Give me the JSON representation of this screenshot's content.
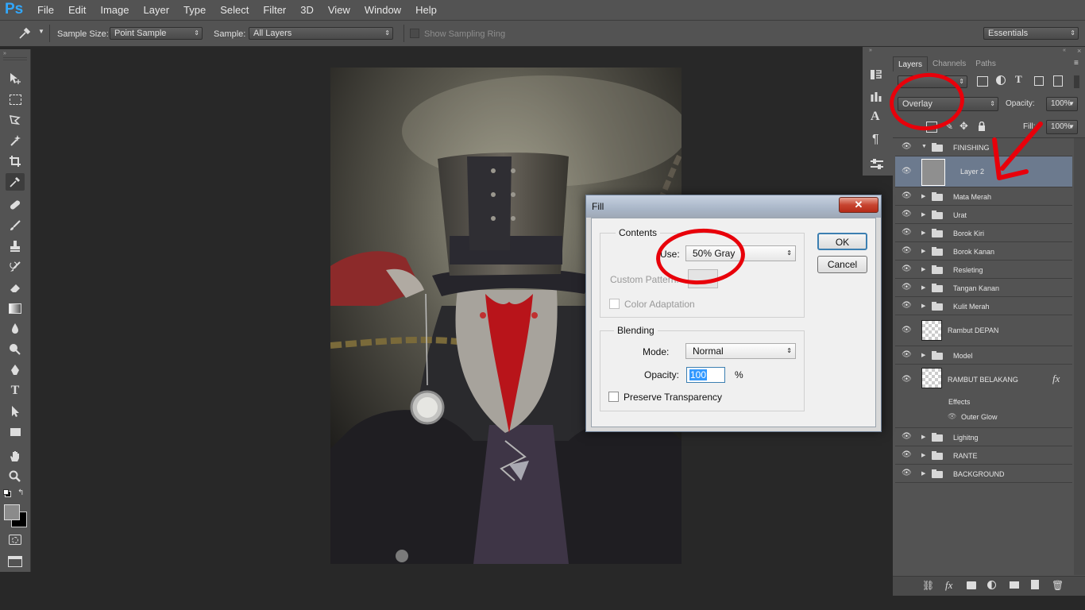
{
  "app": {
    "logo": "Ps"
  },
  "menu": [
    "File",
    "Edit",
    "Image",
    "Layer",
    "Type",
    "Select",
    "Filter",
    "3D",
    "View",
    "Window",
    "Help"
  ],
  "options": {
    "sample_size_label": "Sample Size:",
    "sample_size_value": "Point Sample",
    "sample_label": "Sample:",
    "sample_value": "All Layers",
    "show_ring": "Show Sampling Ring",
    "workspace": "Essentials"
  },
  "tools": [
    "move-tool",
    "marquee-tool",
    "lasso-tool",
    "magic-wand-tool",
    "crop-tool",
    "eyedropper-tool",
    "healing-brush-tool",
    "brush-tool",
    "clone-stamp-tool",
    "history-brush-tool",
    "eraser-tool",
    "gradient-tool",
    "blur-tool",
    "dodge-tool",
    "pen-tool",
    "type-tool",
    "path-selection-tool",
    "rectangle-tool",
    "hand-tool",
    "zoom-tool"
  ],
  "layers_panel": {
    "tabs": [
      "Layers",
      "Channels",
      "Paths"
    ],
    "blend_mode": "Overlay",
    "opacity_label": "Opacity:",
    "opacity_value": "100%",
    "fill_label": "Fill:",
    "fill_value": "100%",
    "layers": [
      {
        "name": "FINISHING",
        "type": "group",
        "expanded": true
      },
      {
        "name": "Layer 2",
        "type": "layer",
        "selected": true
      },
      {
        "name": "Mata Merah",
        "type": "group"
      },
      {
        "name": "Urat",
        "type": "group"
      },
      {
        "name": "Borok Kiri",
        "type": "group"
      },
      {
        "name": "Borok Kanan",
        "type": "group"
      },
      {
        "name": "Resleting",
        "type": "group"
      },
      {
        "name": "Tangan Kanan",
        "type": "group"
      },
      {
        "name": "Kulit Merah",
        "type": "group"
      },
      {
        "name": "Rambut DEPAN",
        "type": "pixel"
      },
      {
        "name": "Model",
        "type": "group"
      },
      {
        "name": "RAMBUT BELAKANG",
        "type": "pixel",
        "fx": "fx"
      },
      {
        "name": "Effects",
        "type": "effects"
      },
      {
        "name": "Outer Glow",
        "type": "effect"
      },
      {
        "name": "Lighitng",
        "type": "group"
      },
      {
        "name": "RANTE",
        "type": "group"
      },
      {
        "name": "BACKGROUND",
        "type": "group"
      }
    ]
  },
  "dialog": {
    "title": "Fill",
    "contents_legend": "Contents",
    "use_label": "Use:",
    "use_value": "50% Gray",
    "custom_pattern": "Custom Pattern:",
    "color_adaptation": "Color Adaptation",
    "blending_legend": "Blending",
    "mode_label": "Mode:",
    "mode_value": "Normal",
    "opacity_label": "Opacity:",
    "opacity_value": "100",
    "opacity_unit": "%",
    "preserve": "Preserve Transparency",
    "ok": "OK",
    "cancel": "Cancel"
  }
}
